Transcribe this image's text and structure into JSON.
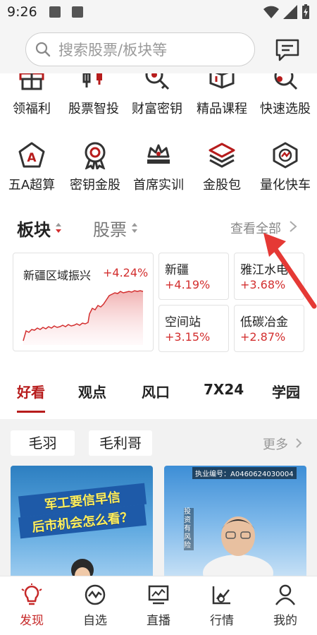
{
  "status": {
    "time": "9:26"
  },
  "search": {
    "placeholder": "搜索股票/板块等"
  },
  "quick_row1": [
    {
      "label": "领福利",
      "icon": "gift-icon"
    },
    {
      "label": "股票智投",
      "icon": "stock-invest-icon"
    },
    {
      "label": "财富密钥",
      "icon": "wealth-key-icon"
    },
    {
      "label": "精品课程",
      "icon": "course-book-icon"
    },
    {
      "label": "快速选股",
      "icon": "stock-search-icon"
    }
  ],
  "quick_row2": [
    {
      "label": "五A超算",
      "icon": "pentagon-a-icon"
    },
    {
      "label": "密钥金股",
      "icon": "medal-icon"
    },
    {
      "label": "首席实训",
      "icon": "crown-icon"
    },
    {
      "label": "金股包",
      "icon": "layers-icon"
    },
    {
      "label": "量化快车",
      "icon": "hexagon-chart-icon"
    }
  ],
  "section": {
    "tab_sector": "板块",
    "tab_stock": "股票",
    "view_all": "查看全部"
  },
  "featured_sector": {
    "name": "新疆区域振兴",
    "change": "+4.24%"
  },
  "sectors": [
    {
      "name": "新疆",
      "change": "+4.19%"
    },
    {
      "name": "雅江水电",
      "change": "+3.68%"
    },
    {
      "name": "空间站",
      "change": "+3.15%"
    },
    {
      "name": "低碳冶金",
      "change": "+2.87%"
    }
  ],
  "content_tabs": [
    "好看",
    "观点",
    "风口",
    "7X24",
    "学园"
  ],
  "feed": {
    "chips": [
      "毛羽",
      "毛利哥"
    ],
    "more": "更多",
    "video1_title_line1": "军工要信早信",
    "video1_title_line2": "后市机会怎么看？",
    "video2_license": "执业编号：A0460624030004",
    "video2_risk": "投资有风险"
  },
  "bottom_nav": [
    {
      "label": "发现",
      "icon": "lightbulb-icon",
      "active": true
    },
    {
      "label": "自选",
      "icon": "watchlist-icon",
      "active": false
    },
    {
      "label": "直播",
      "icon": "live-icon",
      "active": false
    },
    {
      "label": "行情",
      "icon": "market-icon",
      "active": false
    },
    {
      "label": "我的",
      "icon": "profile-icon",
      "active": false
    }
  ],
  "colors": {
    "accent": "#b71c1c",
    "up": "#d32f2f",
    "arrow": "#e53935"
  }
}
